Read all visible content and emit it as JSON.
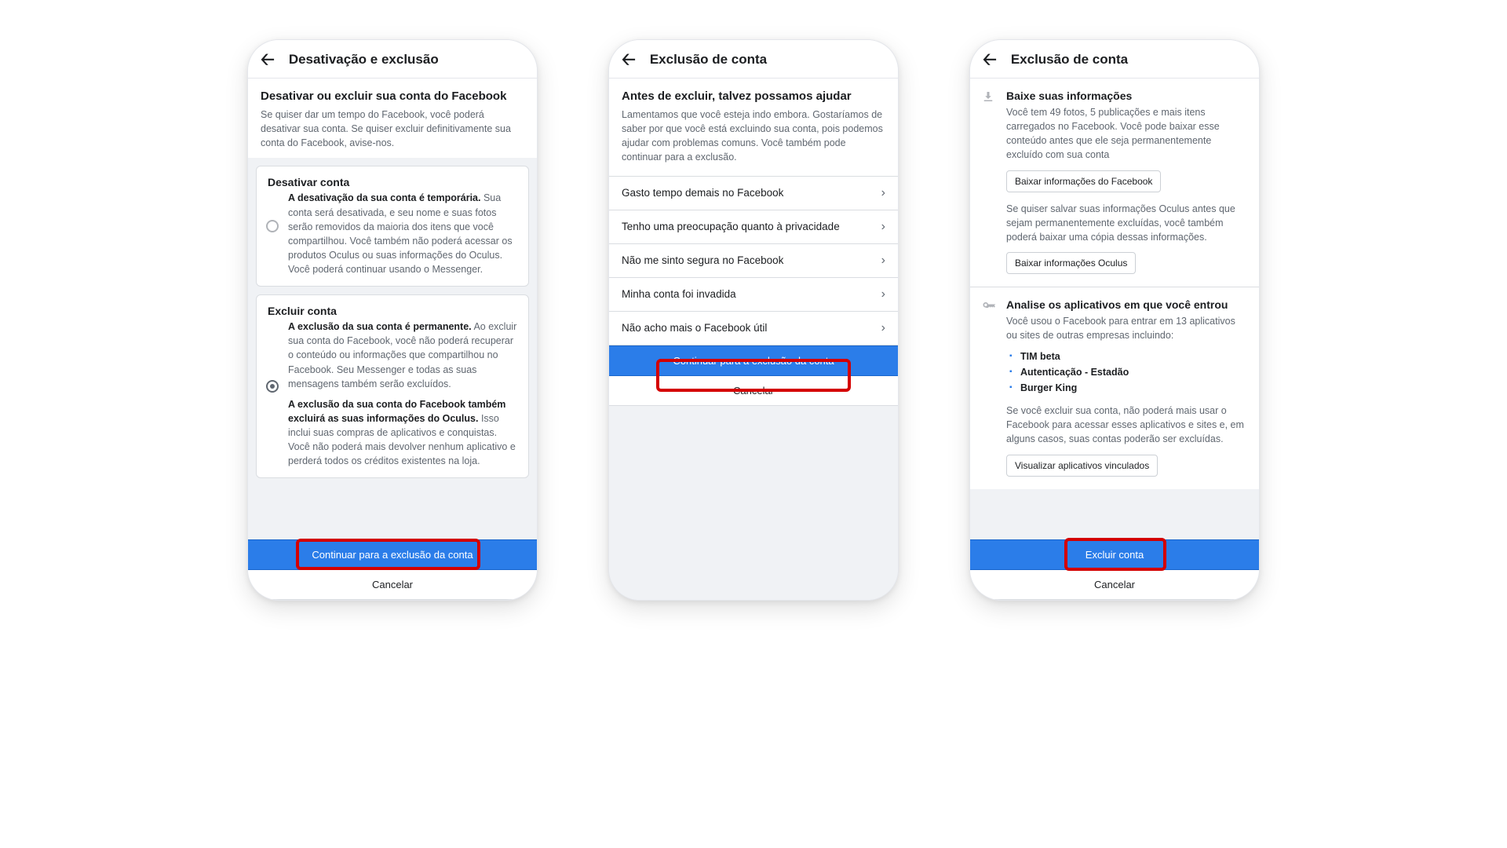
{
  "phone1": {
    "title": "Desativação e exclusão",
    "heading": "Desativar ou excluir sua conta do Facebook",
    "subtext": "Se quiser dar um tempo do Facebook, você poderá desativar sua conta. Se quiser excluir definitivamente sua conta do Facebook, avise-nos.",
    "opt1": {
      "title": "Desativar conta",
      "lead": "A desativação da sua conta é temporária.",
      "body": "Sua conta será desativada, e seu nome e suas fotos serão removidos da maioria dos itens que você compartilhou. Você também não poderá acessar os produtos Oculus ou suas informações do Oculus. Você poderá continuar usando o Messenger."
    },
    "opt2": {
      "title": "Excluir conta",
      "lead": "A exclusão da sua conta é permanente.",
      "body": "Ao excluir sua conta do Facebook, você não poderá recuperar o conteúdo ou informações que compartilhou no Facebook. Seu Messenger e todas as suas mensagens também serão excluídos.",
      "lead2": "A exclusão da sua conta do Facebook também excluirá as suas informações do Oculus.",
      "body2": "Isso inclui suas compras de aplicativos e conquistas. Você não poderá mais devolver nenhum aplicativo e perderá todos os créditos existentes na loja."
    },
    "primary": "Continuar para a exclusão da conta",
    "secondary": "Cancelar"
  },
  "phone2": {
    "title": "Exclusão de conta",
    "heading": "Antes de excluir, talvez possamos ajudar",
    "subtext": "Lamentamos que você esteja indo embora. Gostaríamos de saber por que você está excluindo sua conta, pois podemos ajudar com problemas comuns. Você também pode continuar para a exclusão.",
    "reasons": [
      "Gasto tempo demais no Facebook",
      "Tenho uma preocupação quanto à privacidade",
      "Não me sinto segura no Facebook",
      "Minha conta foi invadida",
      "Não acho mais o Facebook útil"
    ],
    "primary": "Continuar para a exclusão da conta",
    "secondary": "Cancelar"
  },
  "phone3": {
    "title": "Exclusão de conta",
    "download": {
      "heading": "Baixe suas informações",
      "text1": "Você tem 49 fotos, 5 publicações e mais itens carregados no Facebook. Você pode baixar esse conteúdo antes que ele seja permanentemente excluído com sua conta",
      "btn1": "Baixar informações do Facebook",
      "text2": "Se quiser salvar suas informações Oculus antes que sejam permanentemente excluídas, você também poderá baixar uma cópia dessas informações.",
      "btn2": "Baixar informações Oculus"
    },
    "apps": {
      "heading": "Analise os aplicativos em que você entrou",
      "text1": "Você usou o Facebook para entrar em 13 aplicativos ou sites de outras empresas incluindo:",
      "items": [
        "TIM beta",
        "Autenticação - Estadão",
        "Burger King"
      ],
      "text2": "Se você excluir sua conta, não poderá mais usar o Facebook para acessar esses aplicativos e sites e, em alguns casos, suas contas poderão ser excluídas.",
      "btn": "Visualizar aplicativos vinculados"
    },
    "primary": "Excluir conta",
    "secondary": "Cancelar"
  }
}
